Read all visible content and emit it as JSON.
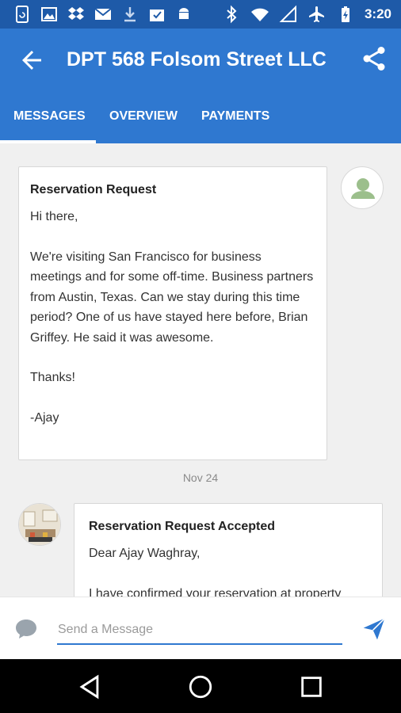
{
  "status_bar": {
    "time": "3:20",
    "left_icons": [
      "phone-sync-icon",
      "image-icon",
      "dropbox-icon",
      "gmail-icon",
      "download-icon",
      "inbox-check-icon",
      "android-icon"
    ],
    "right_icons": [
      "bluetooth-icon",
      "wifi-icon",
      "signal-icon",
      "airplane-icon",
      "battery-charging-icon"
    ]
  },
  "app_bar": {
    "title": "DPT 568 Folsom Street LLC",
    "back_icon": "arrow-back-icon",
    "share_icon": "share-icon"
  },
  "tabs": [
    {
      "label": "MESSAGES",
      "active": true
    },
    {
      "label": "OVERVIEW",
      "active": false
    },
    {
      "label": "PAYMENTS",
      "active": false
    }
  ],
  "messages": [
    {
      "title": "Reservation Request",
      "paragraphs": [
        "Hi there,",
        "We're visiting San Francisco for business meetings and for some off-time. Business partners from Austin, Texas. Can we stay during this time period? One of us have stayed here before, Brian Griffey. He said it was awesome.",
        "Thanks!",
        "-Ajay"
      ]
    },
    {
      "title": "Reservation Request Accepted",
      "paragraphs": [
        "Dear Ajay Waghray,",
        "I have confirmed your reservation at property"
      ]
    }
  ],
  "date_separator": "Nov 24",
  "composer": {
    "placeholder": "Send a Message",
    "chat_icon": "chat-bubble-icon",
    "send_icon": "send-icon"
  },
  "nav_bar": [
    "back-triangle-icon",
    "home-circle-icon",
    "recents-square-icon"
  ],
  "colors": {
    "status_bar": "#1e5aa8",
    "app_bar": "#2f78d0",
    "background": "#f0f0f0",
    "accent": "#2f78d0"
  }
}
